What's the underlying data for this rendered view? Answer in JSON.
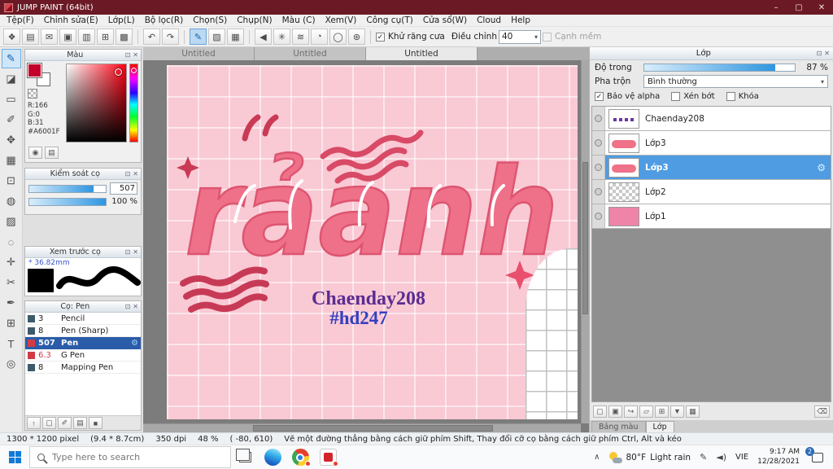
{
  "window": {
    "title": "JUMP PAINT (64bit)"
  },
  "icons": {
    "minimize": "–",
    "maximize": "▢",
    "close": "✕",
    "detach": "⊡",
    "undo": "↶",
    "redo": "↷",
    "check": "✓",
    "dropdown": "▾",
    "gear": "⚙",
    "caret_up": "∧",
    "pen": "✎",
    "speaker": "◄)",
    "trash": "⌫"
  },
  "menu": {
    "items": [
      {
        "label": "Tệp(F)"
      },
      {
        "label": "Chỉnh sửa(E)"
      },
      {
        "label": "Lớp(L)"
      },
      {
        "label": "Bộ lọc(R)"
      },
      {
        "label": "Chọn(S)"
      },
      {
        "label": "Chụp(N)"
      },
      {
        "label": "Màu (C)"
      },
      {
        "label": "Xem(V)"
      },
      {
        "label": "Công cụ(T)"
      },
      {
        "label": "Cửa sổ(W)"
      },
      {
        "label": "Cloud"
      },
      {
        "label": "Help"
      }
    ]
  },
  "toolbar": {
    "left_icons": [
      {
        "glyph": "❖",
        "name": "transform-icon"
      },
      {
        "glyph": "▤",
        "name": "export-icon"
      },
      {
        "glyph": "✉",
        "name": "comment-icon"
      },
      {
        "glyph": "▣",
        "name": "copy-icon"
      },
      {
        "glyph": "▥",
        "name": "pages-icon"
      },
      {
        "glyph": "⊞",
        "name": "grid-edit-icon"
      },
      {
        "glyph": "▩",
        "name": "material-icon"
      }
    ],
    "stroke_icons": [
      {
        "glyph": "✎",
        "name": "pen-stroke-icon",
        "selected": true
      },
      {
        "glyph": "▨",
        "name": "gradient-stroke-icon"
      },
      {
        "glyph": "▦",
        "name": "halftone-stroke-icon"
      }
    ],
    "effect_icons": [
      {
        "glyph": "◀",
        "name": "arrow-shape-icon"
      },
      {
        "glyph": "✳",
        "name": "snowflake-shape-icon"
      },
      {
        "glyph": "≋",
        "name": "wave-shape-icon"
      },
      {
        "glyph": "◔",
        "name": "spiral-shape-icon"
      },
      {
        "glyph": "◯",
        "name": "circle-shape-icon"
      },
      {
        "glyph": "⊛",
        "name": "burst-shape-icon"
      }
    ],
    "antialias_label": "Khử răng cưa",
    "antialias_mark": "✓",
    "adjust_label": "Điều chỉnh",
    "adjust_value": "40",
    "soft_edge_label": "Cạnh mềm"
  },
  "toolstrip": {
    "tools": [
      {
        "glyph": "✎",
        "name": "pen-tool",
        "selected": true
      },
      {
        "glyph": "◪",
        "name": "eraser-tool"
      },
      {
        "glyph": "▭",
        "name": "shape-brush-tool"
      },
      {
        "glyph": "✐",
        "name": "dot-pen-tool"
      },
      {
        "glyph": "✥",
        "name": "move-tool"
      },
      {
        "glyph": "▦",
        "name": "select-tool"
      },
      {
        "glyph": "⊡",
        "name": "select-pen-tool"
      },
      {
        "glyph": "◍",
        "name": "fill-tool"
      },
      {
        "glyph": "▨",
        "name": "gradient-tool"
      },
      {
        "glyph": "◌",
        "name": "lasso-tool"
      },
      {
        "glyph": "✛",
        "name": "wand-tool"
      },
      {
        "glyph": "✂",
        "name": "divide-tool"
      },
      {
        "glyph": "✒",
        "name": "control-tool"
      },
      {
        "glyph": "⊞",
        "name": "grid-tool"
      },
      {
        "glyph": "T",
        "name": "text-tool"
      },
      {
        "glyph": "◎",
        "name": "zoom-tool"
      }
    ]
  },
  "color_panel": {
    "title": "Màu",
    "r": "R:166",
    "g": "G:0",
    "b": "B:31",
    "hex": "#A6001F",
    "footer_icons": [
      {
        "glyph": "◉",
        "name": "color-wheel-icon"
      },
      {
        "glyph": "▤",
        "name": "color-sliders-icon"
      }
    ]
  },
  "brush_control": {
    "title": "Kiểm soát cọ",
    "size_value": "507",
    "opacity_value": "100 %"
  },
  "brush_preview": {
    "title": "Xem trước cọ",
    "size_label": "* 36.82mm"
  },
  "brush_list": {
    "title": "Cọ: Pen",
    "items": [
      {
        "size": "3",
        "name": "Pencil"
      },
      {
        "size": "8",
        "name": "Pen (Sharp)"
      },
      {
        "size": "507",
        "name": "Pen",
        "selected": true,
        "cls": "chip-red",
        "gear": "⚙"
      },
      {
        "size": "6.3",
        "name": "G Pen",
        "cls": "chip-red red-text"
      },
      {
        "size": "8",
        "name": "Mapping Pen"
      }
    ],
    "footer_icons": [
      {
        "glyph": "↑",
        "name": "upload-brush-icon"
      },
      {
        "glyph": "▢",
        "name": "add-brush-icon"
      },
      {
        "glyph": "✐",
        "name": "edit-brush-icon"
      },
      {
        "glyph": "▤",
        "name": "brush-menu-icon"
      },
      {
        "glyph": "■",
        "name": "brush-swatch-icon"
      }
    ]
  },
  "canvas": {
    "tabs": [
      {
        "label": "Untitled"
      },
      {
        "label": "Untitled"
      },
      {
        "label": "Untitled",
        "active": true
      }
    ],
    "word": "rảanh",
    "sig1": "Chaenday208",
    "sig2": "#hd247"
  },
  "layer_panel": {
    "title": "Lớp",
    "opacity_label": "Độ trong",
    "opacity_value": "87 %",
    "blend_label": "Pha trộn",
    "blend_value": "Bình thường",
    "checks": [
      {
        "label": "Bảo vệ alpha",
        "mark": "✓"
      },
      {
        "label": "Xén bớt",
        "mark": ""
      },
      {
        "label": "Khóa",
        "mark": ""
      }
    ],
    "layers": [
      {
        "name": "Chaenday208",
        "cls": "t-sig"
      },
      {
        "name": "Lớp3",
        "cls": "t-art"
      },
      {
        "name": "Lớp3",
        "cls": "t-art",
        "selected": true,
        "gear": "⚙"
      },
      {
        "name": "Lớp2",
        "cls": "t-checker"
      },
      {
        "name": "Lớp1",
        "cls": "t-pink"
      }
    ],
    "footer_icons": [
      {
        "glyph": "▢",
        "name": "new-layer-icon"
      },
      {
        "glyph": "▣",
        "name": "duplicate-layer-icon"
      },
      {
        "glyph": "↪",
        "name": "transfer-layer-icon"
      },
      {
        "glyph": "▱",
        "name": "layer-folder-icon"
      },
      {
        "glyph": "⊞",
        "name": "merge-layer-icon"
      },
      {
        "glyph": "▼",
        "name": "merge-down-icon"
      },
      {
        "glyph": "▦",
        "name": "flatten-icon"
      }
    ],
    "tabs": [
      {
        "label": "Bảng màu"
      },
      {
        "label": "Lớp",
        "active": true
      }
    ]
  },
  "status": {
    "segments": [
      {
        "text": "1300 * 1200 pixel"
      },
      {
        "text": "(9.4 * 8.7cm)"
      },
      {
        "text": "350 dpi"
      },
      {
        "text": "48 %"
      },
      {
        "text": "( -80, 610)"
      },
      {
        "text": "Vẽ một đường thẳng bằng cách giữ phím Shift, Thay đổi cỡ cọ bằng cách giữ phím Ctrl, Alt và kéo"
      }
    ]
  },
  "taskbar": {
    "search_placeholder": "Type here to search",
    "weather_temp": "80°F",
    "weather_desc": "Light rain",
    "language": "VIE",
    "time": "9:17 AM",
    "date": "12/28/2021",
    "badge": "2"
  }
}
